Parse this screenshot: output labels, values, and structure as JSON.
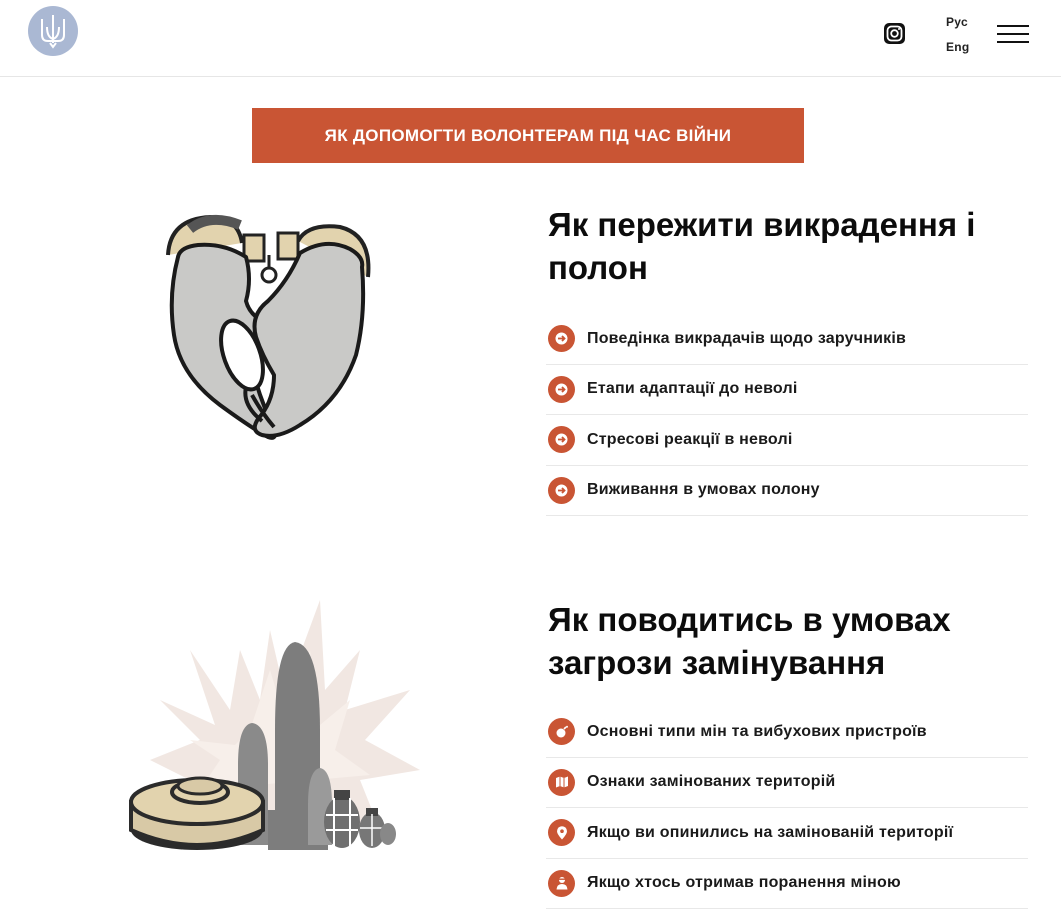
{
  "header": {
    "logo_icon": "trident-emblem-icon",
    "social_icon": "instagram-icon",
    "languages": [
      "Рус",
      "Eng"
    ],
    "menu_icon": "hamburger-menu-icon"
  },
  "cta": {
    "label": "ЯК ДОПОМОГТИ ВОЛОНТЕРАМ ПІД ЧАС ВІЙНИ"
  },
  "sections": [
    {
      "illustration": "handcuffed-hands-illustration",
      "title": "Як пережити викрадення і полон",
      "items": [
        {
          "label": "Поведінка викрадачів щодо заручників",
          "icon": "arrow-right-icon"
        },
        {
          "label": "Етапи адаптації до неволі",
          "icon": "arrow-right-icon"
        },
        {
          "label": "Стресові реакції в неволі",
          "icon": "arrow-right-icon"
        },
        {
          "label": "Виживання в умовах полону",
          "icon": "arrow-right-icon"
        }
      ]
    },
    {
      "illustration": "landmine-and-ordnance-illustration",
      "title": "Як поводитись в умовах загрози замінування",
      "items": [
        {
          "label": "Основні типи мін та вибухових пристроїв",
          "icon": "bomb-icon"
        },
        {
          "label": "Ознаки замінованих територій",
          "icon": "map-icon"
        },
        {
          "label": "Якщо ви опинились на замінованій території",
          "icon": "location-pin-icon"
        },
        {
          "label": "Якщо хтось отримав поранення міною",
          "icon": "injured-person-icon"
        }
      ]
    }
  ],
  "colors": {
    "accent": "#c95534",
    "logo_bg": "#aab8d3",
    "divider": "#e8e8e8"
  }
}
